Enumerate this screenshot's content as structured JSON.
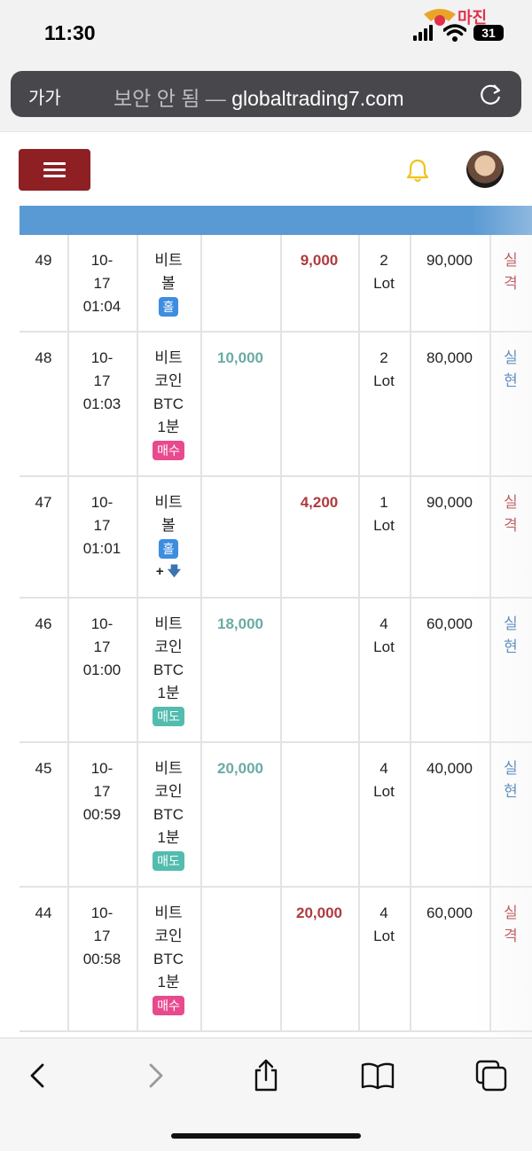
{
  "status_bar": {
    "time": "11:30",
    "battery": "31",
    "watermark": "마진"
  },
  "browser": {
    "text_size_label": "가가",
    "security_label": "보안 안 됨 — ",
    "url": "globaltrading7.com"
  },
  "table": {
    "rows": [
      {
        "no": "49",
        "date": "10-",
        "day": "17",
        "time": "01:04",
        "cat1": "비트",
        "cat2": "볼",
        "cat3": "",
        "cat4": "",
        "badge": "홀",
        "badge_color": "#3d8de0",
        "extra": "",
        "deposit": "",
        "withdraw": "9,000",
        "qty": "2",
        "unit": "Lot",
        "holding": "90,000",
        "res1": "실",
        "res2": "격",
        "res_color": "#b03a3e"
      },
      {
        "no": "48",
        "date": "10-",
        "day": "17",
        "time": "01:03",
        "cat1": "비트",
        "cat2": "코인",
        "cat3": "BTC",
        "cat4": "1분",
        "badge": "매수",
        "badge_color": "#e84a8e",
        "extra": "",
        "deposit": "10,000",
        "withdraw": "",
        "qty": "2",
        "unit": "Lot",
        "holding": "80,000",
        "res1": "실",
        "res2": "현",
        "res_color": "#3b74b2"
      },
      {
        "no": "47",
        "date": "10-",
        "day": "17",
        "time": "01:01",
        "cat1": "비트",
        "cat2": "볼",
        "cat3": "",
        "cat4": "",
        "badge": "홀",
        "badge_color": "#3d8de0",
        "extra": "+",
        "deposit": "",
        "withdraw": "4,200",
        "qty": "1",
        "unit": "Lot",
        "holding": "90,000",
        "res1": "실",
        "res2": "격",
        "res_color": "#b03a3e"
      },
      {
        "no": "46",
        "date": "10-",
        "day": "17",
        "time": "01:00",
        "cat1": "비트",
        "cat2": "코인",
        "cat3": "BTC",
        "cat4": "1분",
        "badge": "매도",
        "badge_color": "#52bcae",
        "extra": "",
        "deposit": "18,000",
        "withdraw": "",
        "qty": "4",
        "unit": "Lot",
        "holding": "60,000",
        "res1": "실",
        "res2": "현",
        "res_color": "#3b74b2"
      },
      {
        "no": "45",
        "date": "10-",
        "day": "17",
        "time": "00:59",
        "cat1": "비트",
        "cat2": "코인",
        "cat3": "BTC",
        "cat4": "1분",
        "badge": "매도",
        "badge_color": "#52bcae",
        "extra": "",
        "deposit": "20,000",
        "withdraw": "",
        "qty": "4",
        "unit": "Lot",
        "holding": "40,000",
        "res1": "실",
        "res2": "현",
        "res_color": "#3b74b2"
      },
      {
        "no": "44",
        "date": "10-",
        "day": "17",
        "time": "00:58",
        "cat1": "비트",
        "cat2": "코인",
        "cat3": "BTC",
        "cat4": "1분",
        "badge": "매수",
        "badge_color": "#e84a8e",
        "extra": "",
        "deposit": "",
        "withdraw": "20,000",
        "qty": "4",
        "unit": "Lot",
        "holding": "60,000",
        "res1": "실",
        "res2": "격",
        "res_color": "#b03a3e"
      }
    ]
  },
  "colors": {
    "header_blue": "#5a9ad4",
    "menu_red": "#8e2024",
    "bell_yellow": "#f2c21a"
  },
  "toolbar": {
    "icons": [
      "back-icon",
      "forward-icon",
      "share-icon",
      "bookmarks-icon",
      "tabs-icon"
    ]
  }
}
